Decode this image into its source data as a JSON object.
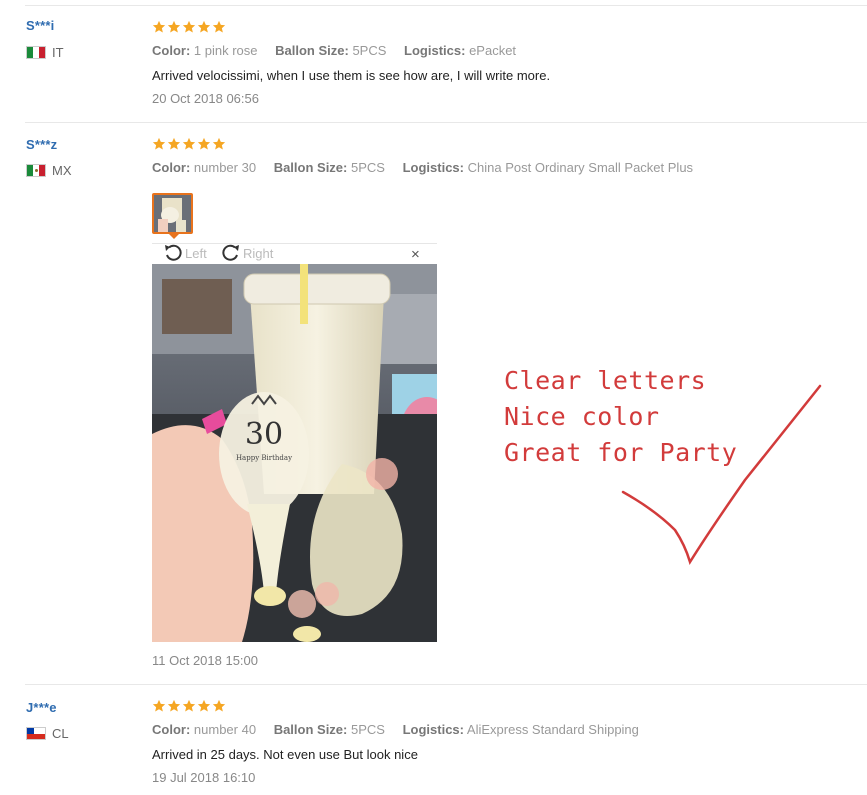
{
  "reviews": [
    {
      "user": "S***i",
      "country": "IT",
      "flag_colors": [
        "#1a8a3a",
        "#ffffff",
        "#c8202f"
      ],
      "rating": 5,
      "color_label": "Color:",
      "color_value": "1 pink rose",
      "size_label": "Ballon Size:",
      "size_value": "5PCS",
      "logistics_label": "Logistics:",
      "logistics_value": "ePacket",
      "content": "Arrived velocissimi, when I use them is see how are, I will write more.",
      "date": "20 Oct 2018 06:56"
    },
    {
      "user": "S***z",
      "country": "MX",
      "flag_colors": [
        "#1a8a3a",
        "#ffffff",
        "#c8202f"
      ],
      "rating": 5,
      "color_label": "Color:",
      "color_value": "number 30",
      "size_label": "Ballon Size:",
      "size_value": "5PCS",
      "logistics_label": "Logistics:",
      "logistics_value": "China Post Ordinary Small Packet Plus",
      "date": "11 Oct 2018 15:00",
      "viewer": {
        "rotate_left": "Left",
        "rotate_right": "Right",
        "close": "×",
        "balloon_number": "30",
        "balloon_text": "Happy Birthday"
      }
    },
    {
      "user": "J***e",
      "country": "CL",
      "flag_colors": [
        "#ffffff",
        "#d52b1e",
        "#0039a6"
      ],
      "rating": 5,
      "color_label": "Color:",
      "color_value": "number 40",
      "size_label": "Ballon Size:",
      "size_value": "5PCS",
      "logistics_label": "Logistics:",
      "logistics_value": "AliExpress Standard Shipping",
      "content": "Arrived in 25 days. Not even use But look nice",
      "date": "19 Jul 2018 16:10"
    }
  ],
  "overlay": {
    "line1": "Clear letters",
    "line2": "Nice color",
    "line3": "Great for Party",
    "color": "#d23b3b"
  },
  "colors": {
    "star": "#f5a623",
    "username": "#2f6cb0",
    "thumb_border": "#e8731d"
  }
}
